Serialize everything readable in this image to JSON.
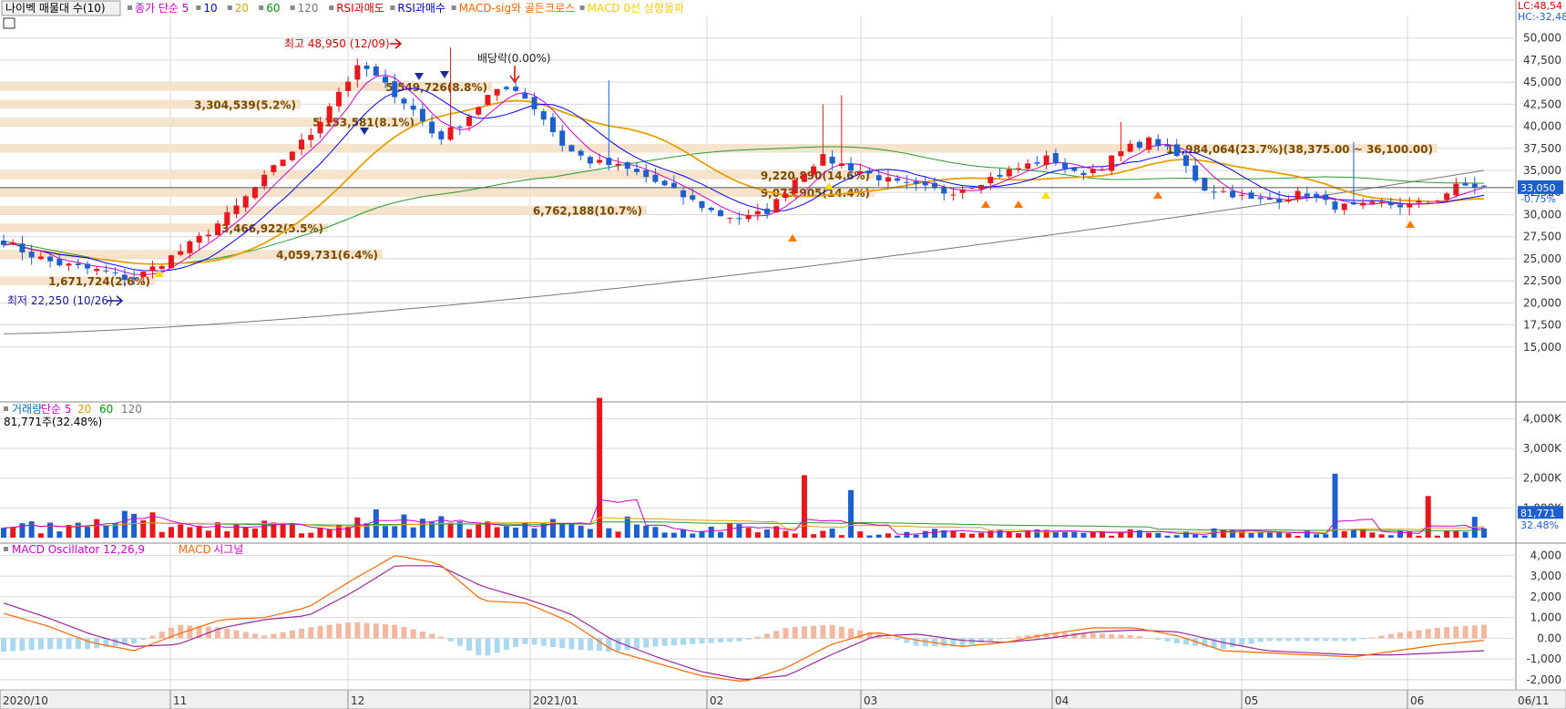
{
  "header": {
    "title_button": "나이벡 매물대 수(10)",
    "legend": [
      {
        "text": "종가 단순 5",
        "color": "#cc00cc"
      },
      {
        "text": "10",
        "color": "#0000ff"
      },
      {
        "text": "20",
        "color": "#e8a000"
      },
      {
        "text": "60",
        "color": "#009900"
      },
      {
        "text": "120",
        "color": "#777777"
      },
      {
        "text": "RSI과매도",
        "color": "#cc0000"
      },
      {
        "text": "RSI과매수",
        "color": "#0000cc"
      },
      {
        "text": "MACD-sig와 골든크로스",
        "color": "#ff6600"
      },
      {
        "text": "MACD 0선 상향돌파",
        "color": "#ffcc00"
      }
    ],
    "lc_label": "LC:48,54",
    "hc_label": "HC:-32,48",
    "volume_legend": [
      {
        "text": "거래량",
        "color": "#0070c0"
      },
      {
        "text": "단순 5",
        "color": "#cc00cc"
      },
      {
        "text": "20",
        "color": "#e8a000"
      },
      {
        "text": "60",
        "color": "#009900"
      },
      {
        "text": "120",
        "color": "#777777"
      }
    ],
    "volume_value": "81,771주(32.48%)",
    "macd_legend": [
      {
        "text": "MACD Oscillator 12,26,9",
        "color": "#cc00cc"
      },
      {
        "text": "MACD",
        "color": "#ff6600"
      },
      {
        "text": "시그널",
        "color": "#cc00cc"
      }
    ]
  },
  "colors": {
    "up": "#e8171c",
    "down": "#1e5fd0",
    "zone": "#f5e3cc",
    "grid": "#d8d8d8",
    "osc_pos": "#f4b8a0",
    "osc_neg": "#a9d8f0"
  },
  "chart_data": [
    {
      "type": "candlestick",
      "x": [
        "2020/10",
        "11",
        "12",
        "2021/01",
        "02",
        "03",
        "04",
        "05",
        "06",
        "06/11"
      ],
      "y_ticks": [
        "50,000",
        "47,500",
        "45,000",
        "42,500",
        "40,000",
        "37,500",
        "35,000",
        "32,500",
        "30,000",
        "27,500",
        "25,000",
        "22,500",
        "20,000",
        "17,500",
        "15,000"
      ],
      "ylim": [
        12500,
        51000
      ],
      "current_price": "33,050",
      "current_change": "-0.75%",
      "annotations": [
        "최고 48,950 (12/09)",
        "최저 22,250 (10/26)",
        "배당락(0.00%)"
      ],
      "price_zones": [
        {
          "low": 44000,
          "high": 45000,
          "label": "5,549,726(8.8%)"
        },
        {
          "low": 42000,
          "high": 43000,
          "label": "3,304,539(5.2%)"
        },
        {
          "low": 40000,
          "high": 41000,
          "label": "5,153,581(8.1%)"
        },
        {
          "low": 37000,
          "high": 38000,
          "label": "15,984,064(23.7%)(38,375.00 ~ 36,100.00)"
        },
        {
          "low": 34000,
          "high": 35000,
          "label": "9,220,890(14.6%)"
        },
        {
          "low": 32000,
          "high": 33000,
          "label": "9,073,905(14.4%)"
        },
        {
          "low": 30000,
          "high": 31000,
          "label": "6,762,188(10.7%)"
        },
        {
          "low": 28000,
          "high": 29000,
          "label": "3,466,922(5.5%)"
        },
        {
          "low": 25000,
          "high": 26000,
          "label": "4,059,731(6.4%)"
        },
        {
          "low": 22000,
          "high": 23000,
          "label": "1,671,724(2.6%)"
        }
      ],
      "close_path": [
        27000,
        25500,
        24500,
        24000,
        23500,
        22600,
        24200,
        26000,
        28000,
        30500,
        33500,
        36500,
        39000,
        43500,
        47000,
        44500,
        42000,
        38500,
        40500,
        43500,
        44500,
        41500,
        37500,
        36000,
        35500,
        34500,
        33000,
        31500,
        30000,
        29500,
        30500,
        34000,
        36500,
        35500,
        34500,
        33500,
        33000,
        32500,
        33500,
        34500,
        35500,
        36500,
        34500,
        35500,
        37500,
        38500,
        36500,
        33000,
        32500,
        31500,
        31800,
        32500,
        31000,
        30800,
        31200,
        31000,
        31500,
        33300,
        33050
      ],
      "high": "48,950",
      "low": "22,250"
    },
    {
      "type": "bar",
      "y_ticks": [
        "4,000K",
        "3,000K",
        "2,000K",
        "1,000K"
      ],
      "ylim": [
        0,
        4900
      ],
      "current_volume": "81,771",
      "current_ratio": "32.48%",
      "spikes": [
        {
          "x": "2021/01",
          "value": 4700
        },
        {
          "x": "02",
          "value": 2100
        },
        {
          "x": "02",
          "value": 1600
        },
        {
          "x": "05",
          "value": 2150
        },
        {
          "x": "06",
          "value": 1400
        }
      ]
    },
    {
      "type": "line",
      "y_ticks": [
        "4,000",
        "3,000",
        "2,000",
        "1,000",
        "0.00",
        "-1,000",
        "-2,000"
      ],
      "ylim": [
        -2400,
        4500
      ],
      "macd_path": [
        1200,
        600,
        -200,
        -600,
        200,
        900,
        1000,
        1500,
        2800,
        4000,
        3600,
        1800,
        1700,
        800,
        -600,
        -1200,
        -1800,
        -2100,
        -1400,
        -300,
        300,
        -100,
        -400,
        -200,
        200,
        500,
        500,
        100,
        -600,
        -700,
        -800,
        -900,
        -600,
        -300,
        -100
      ],
      "signal_path": [
        1700,
        1000,
        200,
        -400,
        -300,
        500,
        900,
        1100,
        2200,
        3500,
        3500,
        2500,
        1900,
        1200,
        -100,
        -900,
        -1600,
        -2000,
        -1800,
        -800,
        100,
        200,
        -100,
        -200,
        0,
        300,
        400,
        300,
        -200,
        -600,
        -700,
        -800,
        -800,
        -700,
        -600
      ]
    }
  ]
}
